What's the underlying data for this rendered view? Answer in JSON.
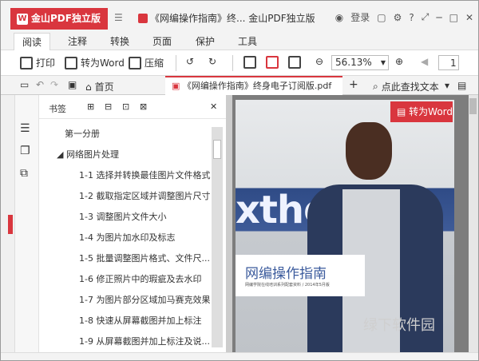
{
  "app": {
    "name": "金山PDF独立版",
    "title": "《网编操作指南》终... 金山PDF独立版",
    "login": "登录"
  },
  "menu": {
    "tabs": [
      "阅读",
      "注释",
      "转换",
      "页面",
      "保护",
      "工具"
    ]
  },
  "toolbar": {
    "print": "打印",
    "to_word": "转为Word",
    "compress": "压缩",
    "zoom": "56.13%",
    "page": "1"
  },
  "tabs": {
    "home": "首页",
    "doc": "《网编操作指南》终身电子订阅版.pdf",
    "find": "点此查找文本"
  },
  "bookmarks": {
    "title": "书签",
    "items": [
      "第一分册",
      "网络图片处理",
      "1-1 选择并转换最佳图片文件格式",
      "1-2 截取指定区域并调整图片尺寸",
      "1-3 调整图片文件大小",
      "1-4 为图片加水印及标志",
      "1-5 批量调整图片格式、文件尺...",
      "1-6 修正照片中的瑕疵及去水印",
      "1-7 为图片部分区域加马赛克效果",
      "1-8 快速从屏幕截图并加上标注",
      "1-9 从屏幕截图并加上标注及说..."
    ]
  },
  "document": {
    "big_text": "xthe",
    "cover_title": "网编操作指南",
    "cover_subtitle": "网编学院在线培训系列配套资料 / 2014年5月版",
    "to_word_button": "转为Word"
  },
  "watermark": {
    "text": "绿下软件园"
  },
  "colors": {
    "accent": "#d9363e",
    "brand_blue": "#3a5a9c"
  }
}
